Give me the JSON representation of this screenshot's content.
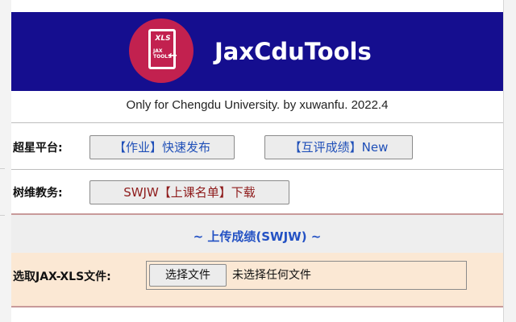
{
  "banner": {
    "app_title": "JaxCduTools",
    "logo": {
      "icon": "xls-tools-icon",
      "label_xls": "XLS",
      "label_jax": "JAX",
      "label_tools": "TOOLS"
    },
    "background_color": "#150e8f",
    "logo_color": "#c2214f"
  },
  "subtitle": "Only for Chengdu University. by xuwanfu. 2022.4",
  "chaoxing": {
    "label": "超星平台:",
    "buttons": [
      {
        "label": "【作业】快速发布"
      },
      {
        "label": "【互评成绩】New"
      }
    ]
  },
  "shuwei": {
    "label": "树维教务:",
    "buttons": [
      {
        "label": "SWJW【上课名单】下载"
      }
    ]
  },
  "upload": {
    "title": "~ 上传成绩(SWJW) ~",
    "field_label": "选取JAX-XLS文件:",
    "choose_button": "选择文件",
    "no_file_text": "未选择任何文件"
  },
  "colors": {
    "accent_blue": "#2452c4",
    "accent_red": "#8e1b1b",
    "upload_bg": "#fbe8d4"
  }
}
